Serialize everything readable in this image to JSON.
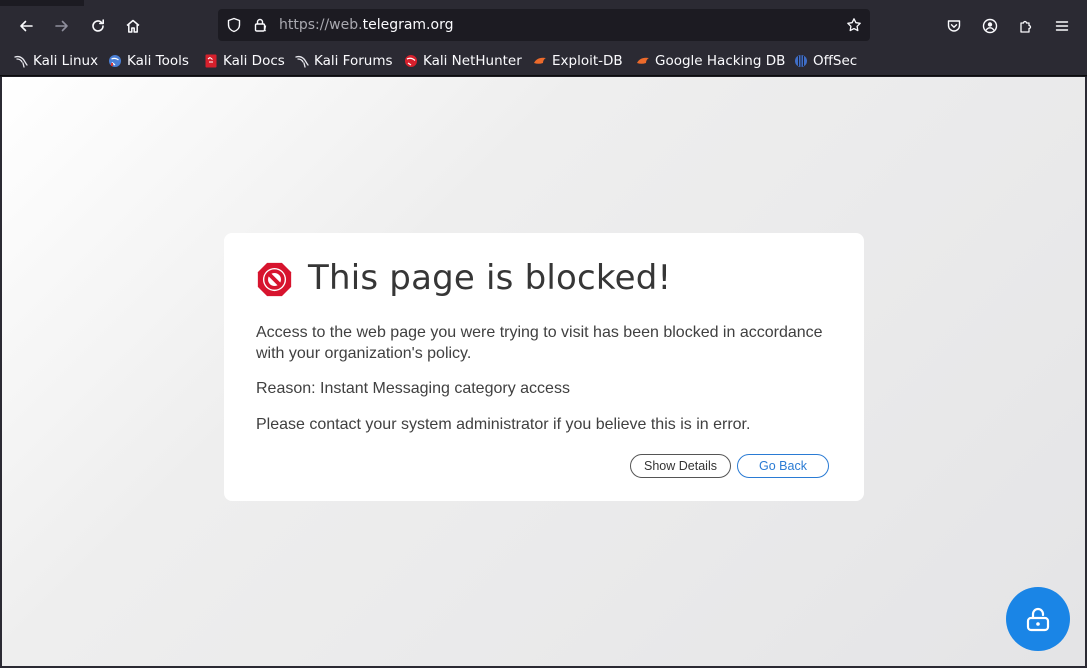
{
  "browser": {
    "url_scheme_host_dim": "https://web.",
    "url_domain": "telegram.org",
    "bookmarks": [
      {
        "label": "Kali Linux",
        "icon": "kali-dragon-icon"
      },
      {
        "label": "Kali Tools",
        "icon": "kali-tools-icon"
      },
      {
        "label": "Kali Docs",
        "icon": "kali-docs-icon"
      },
      {
        "label": "Kali Forums",
        "icon": "kali-dragon-icon"
      },
      {
        "label": "Kali NetHunter",
        "icon": "nethunter-icon"
      },
      {
        "label": "Exploit-DB",
        "icon": "exploit-db-icon"
      },
      {
        "label": "Google Hacking DB",
        "icon": "exploit-db-icon"
      },
      {
        "label": "OffSec",
        "icon": "offsec-icon"
      }
    ]
  },
  "block_page": {
    "title": "This page is blocked!",
    "message": "Access to the web page you were trying to visit has been blocked in accordance with your organization's policy.",
    "reason": "Reason: Instant Messaging category access",
    "contact": "Please contact your system administrator if you believe this is in error.",
    "show_details_label": "Show Details",
    "go_back_label": "Go Back"
  },
  "colors": {
    "block_icon": "#d7142e",
    "accent": "#2a7bd4",
    "fab": "#1a85e6"
  }
}
